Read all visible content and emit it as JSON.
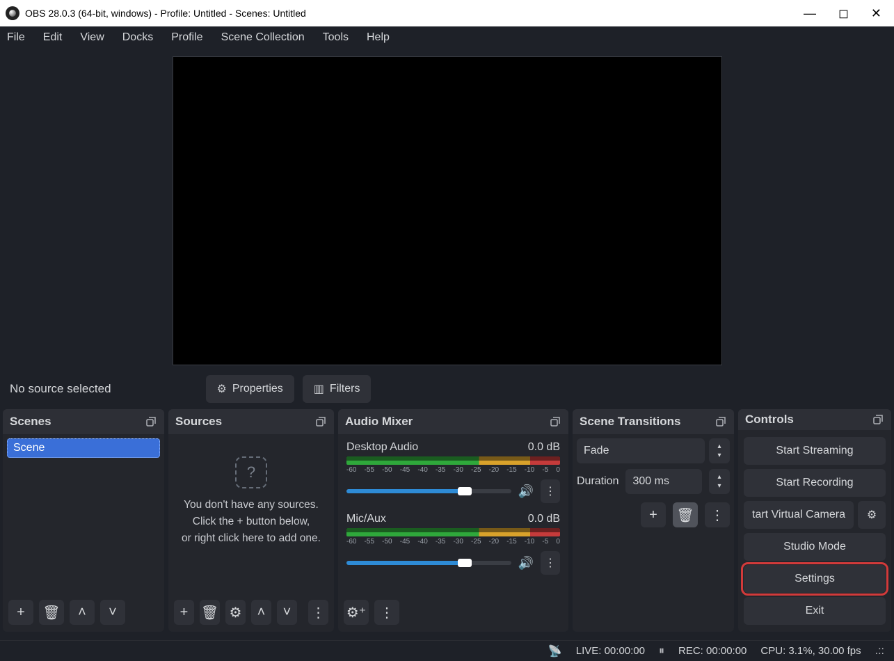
{
  "window": {
    "title": "OBS 28.0.3 (64-bit, windows) - Profile: Untitled - Scenes: Untitled",
    "minimize_icon": "—",
    "maximize_icon": "◻",
    "close_icon": "✕"
  },
  "menubar": [
    "File",
    "Edit",
    "View",
    "Docks",
    "Profile",
    "Scene Collection",
    "Tools",
    "Help"
  ],
  "context_bar": {
    "status_text": "No source selected",
    "properties_label": "Properties",
    "filters_label": "Filters"
  },
  "docks": {
    "scenes": {
      "title": "Scenes",
      "items": [
        "Scene"
      ]
    },
    "sources": {
      "title": "Sources",
      "empty_icon": "?",
      "empty_text_line1": "You don't have any sources.",
      "empty_text_line2": "Click the + button below,",
      "empty_text_line3": "or right click here to add one."
    },
    "mixer": {
      "title": "Audio Mixer",
      "ticks": [
        "-60",
        "-55",
        "-50",
        "-45",
        "-40",
        "-35",
        "-30",
        "-25",
        "-20",
        "-15",
        "-10",
        "-5",
        "0"
      ],
      "channels": [
        {
          "name": "Desktop Audio",
          "db": "0.0 dB"
        },
        {
          "name": "Mic/Aux",
          "db": "0.0 dB"
        }
      ]
    },
    "transitions": {
      "title": "Scene Transitions",
      "selected": "Fade",
      "duration_label": "Duration",
      "duration_value": "300 ms"
    },
    "controls": {
      "title": "Controls",
      "start_streaming": "Start Streaming",
      "start_recording": "Start Recording",
      "virtual_cam": "tart Virtual Camera",
      "studio_mode": "Studio Mode",
      "settings": "Settings",
      "exit": "Exit"
    }
  },
  "statusbar": {
    "live": "LIVE: 00:00:00",
    "rec": "REC: 00:00:00",
    "cpu": "CPU: 3.1%, 30.00 fps"
  },
  "icons": {
    "plus": "+",
    "trash": "🗑",
    "up": "˄",
    "down": "˅",
    "gear": "⚙",
    "dots_v": "⋮",
    "gear_adv": "⚙⁺",
    "speaker": "🔊",
    "filters": "▥",
    "broadcast": "📡",
    "pause": "⏸",
    "grip": ".::"
  }
}
